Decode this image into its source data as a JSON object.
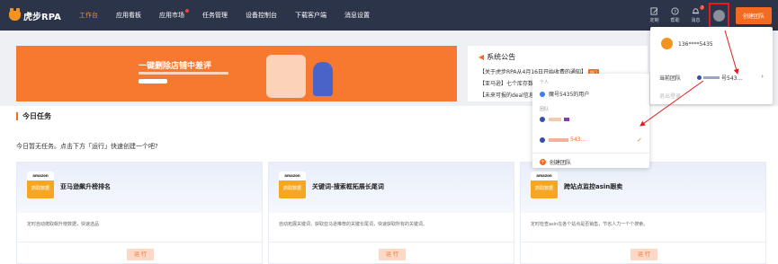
{
  "brand": {
    "name": "虎步RPA"
  },
  "nav": {
    "items": [
      {
        "label": "工作台"
      },
      {
        "label": "应用看板"
      },
      {
        "label": "应用市场"
      },
      {
        "label": "任务管理"
      },
      {
        "label": "设备控制台"
      },
      {
        "label": "下载客户端"
      },
      {
        "label": "消息设置"
      }
    ],
    "active_index": 0,
    "tools": [
      {
        "label": "定制",
        "icon": "edit-icon"
      },
      {
        "label": "帮助",
        "icon": "help-icon"
      },
      {
        "label": "消息",
        "icon": "bell-icon",
        "badge": "7"
      }
    ],
    "create_button": "创建团队"
  },
  "banner": {
    "title": "一键删除店铺中差评"
  },
  "notice": {
    "title": "系统公告",
    "lines": [
      "【关于虎步RPA从4月16日开始收费的通知】",
      "【亚马逊】七个库存数据",
      "【未来可报的deal信息"
    ],
    "hot_label": "热门"
  },
  "tasks": {
    "section_title": "今日任务",
    "empty_text": "今日暂无任务。点击下方「运行」快速创建一个吧?",
    "cards": [
      {
        "logo_text": "amazon",
        "logo_sub": "抓取数据",
        "title": "亚马逊飙升榜排名",
        "desc": "定时自动爬取飙升榜数据，快速选品",
        "run": "运 行"
      },
      {
        "logo_text": "amazon",
        "logo_sub": "抓取数据",
        "title": "关键词-搜索框拓展长尾词",
        "desc": "自动拓展关键词，获取亚马逊推荐的关键长尾词，快速获取所有的关键词。",
        "run": "运 行"
      },
      {
        "logo_text": "amazon",
        "logo_sub": "抓取数据",
        "title": "跨站点监控asin跟卖",
        "desc": "定时检查asin在各个站点是否销售，节省人力一个个搜索。",
        "run": "运 行"
      }
    ]
  },
  "team_dropdown": {
    "personal_label": "个人",
    "personal_item": "魔号5435的用户",
    "team_label": "团队",
    "team_item_2_suffix": "543...",
    "create_team": "创建团队"
  },
  "user_panel": {
    "phone": "136****5435",
    "current_team_label": "当前团队",
    "current_team_value": "号543...",
    "logout": "退出登录"
  },
  "colors": {
    "accent": "#f36b21",
    "nav_bg": "#2b3448",
    "highlight": "#e21b1b"
  }
}
